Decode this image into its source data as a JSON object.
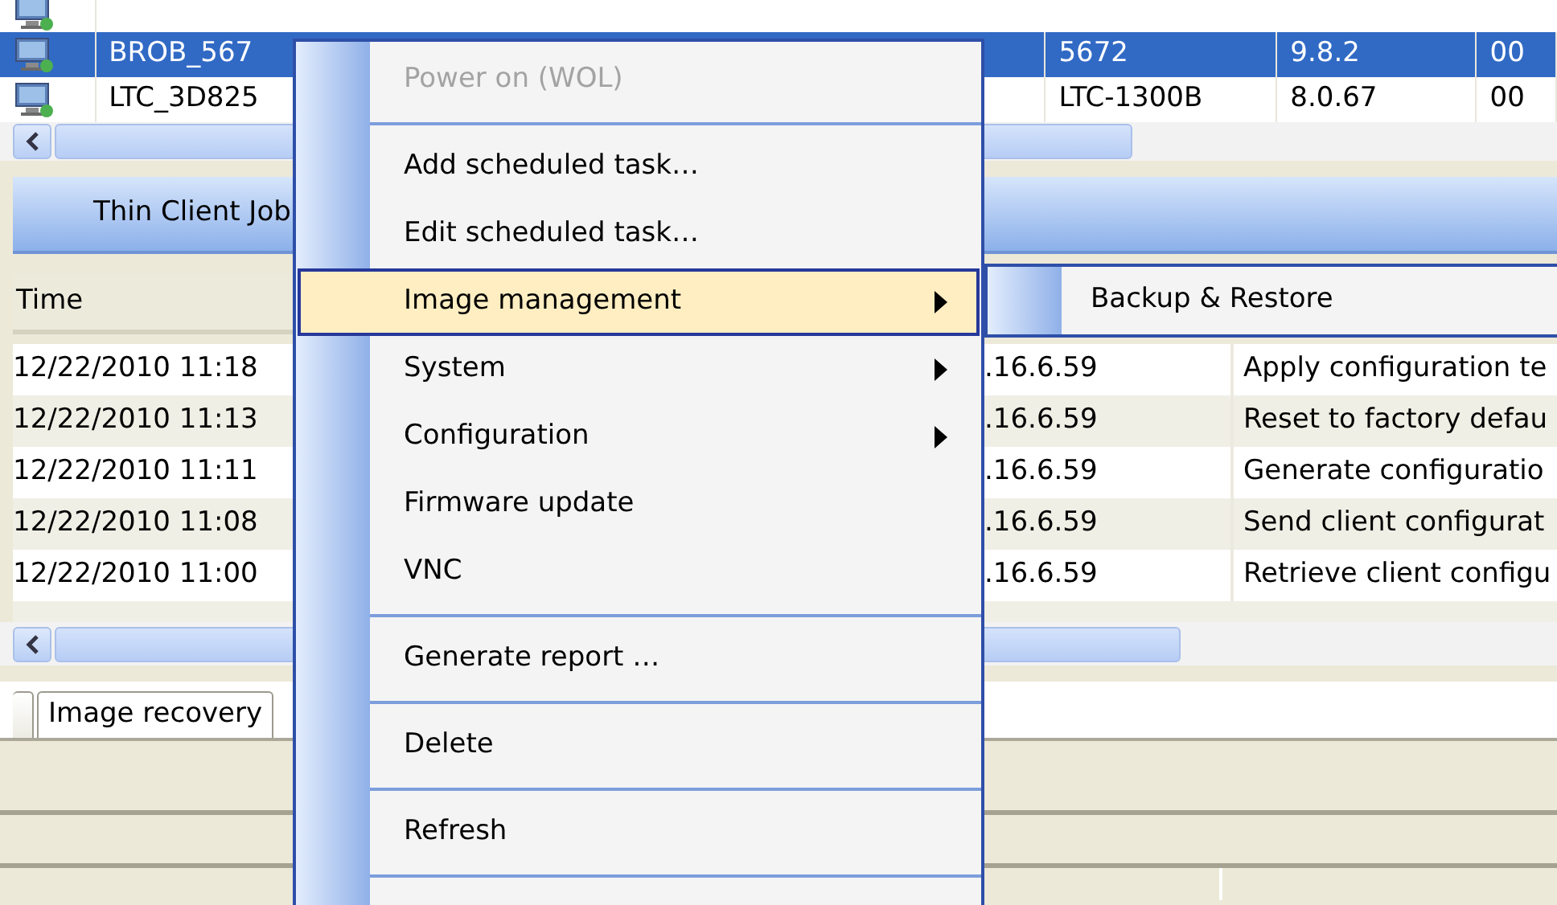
{
  "devices_table": {
    "rows": [
      {
        "name": "BROB_567",
        "column_5": "5672",
        "column_6": "9.8.2",
        "column_7": "00",
        "selected": true
      },
      {
        "name": "LTC_3D825",
        "column_5": "LTC-1300B",
        "column_6": "8.0.67",
        "column_7": "00",
        "selected": false
      }
    ]
  },
  "job_panel": {
    "title": "Thin Client Job"
  },
  "jobs_table": {
    "columns": [
      "Time"
    ],
    "rows": [
      {
        "time": "12/22/2010 11:18",
        "column_3": ".16.6.59",
        "column_4": "Apply configuration te"
      },
      {
        "time": "12/22/2010 11:13",
        "column_3": ".16.6.59",
        "column_4": "Reset to factory defau"
      },
      {
        "time": "12/22/2010 11:11",
        "column_3": ".16.6.59",
        "column_4": "Generate configuratio"
      },
      {
        "time": "12/22/2010 11:08",
        "column_3": ".16.6.59",
        "column_4": "Send client configurat"
      },
      {
        "time": "12/22/2010 11:00",
        "column_3": ".16.6.59",
        "column_4": "Retrieve client configu"
      }
    ]
  },
  "tabs": [
    {
      "label": "Image recovery",
      "selected": true
    }
  ],
  "context_menu": {
    "items": [
      {
        "kind": "item",
        "label": "Power on (WOL)",
        "disabled": true,
        "highlighted": false,
        "submenu": false
      },
      {
        "kind": "separator"
      },
      {
        "kind": "item",
        "label": "Add scheduled task…",
        "disabled": false,
        "highlighted": false,
        "submenu": false
      },
      {
        "kind": "item",
        "label": "Edit scheduled task…",
        "disabled": false,
        "highlighted": false,
        "submenu": false
      },
      {
        "kind": "item",
        "label": "Image management",
        "disabled": false,
        "highlighted": true,
        "submenu": true
      },
      {
        "kind": "item",
        "label": "System",
        "disabled": false,
        "highlighted": false,
        "submenu": true
      },
      {
        "kind": "item",
        "label": "Configuration",
        "disabled": false,
        "highlighted": false,
        "submenu": true
      },
      {
        "kind": "item",
        "label": "Firmware update",
        "disabled": false,
        "highlighted": false,
        "submenu": false
      },
      {
        "kind": "item",
        "label": "VNC",
        "disabled": false,
        "highlighted": false,
        "submenu": false
      },
      {
        "kind": "separator"
      },
      {
        "kind": "item",
        "label": "Generate report …",
        "disabled": false,
        "highlighted": false,
        "submenu": false
      },
      {
        "kind": "separator"
      },
      {
        "kind": "item",
        "label": "Delete",
        "disabled": false,
        "highlighted": false,
        "submenu": false
      },
      {
        "kind": "separator"
      },
      {
        "kind": "item",
        "label": "Refresh",
        "disabled": false,
        "highlighted": false,
        "submenu": false
      },
      {
        "kind": "separator"
      }
    ]
  },
  "submenu": {
    "items": [
      {
        "label": "Backup & Restore"
      }
    ]
  }
}
